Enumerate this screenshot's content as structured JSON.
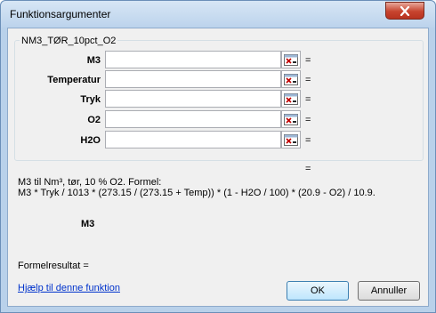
{
  "window": {
    "title": "Funktionsargumenter"
  },
  "function_name": "NM3_TØR_10pct_O2",
  "arguments": [
    {
      "label": "M3",
      "value": ""
    },
    {
      "label": "Temperatur",
      "value": ""
    },
    {
      "label": "Tryk",
      "value": ""
    },
    {
      "label": "O2",
      "value": ""
    },
    {
      "label": "H2O",
      "value": ""
    }
  ],
  "equals": "=",
  "description": {
    "line1": "M3 til Nm³, tør, 10 % O2. Formel:",
    "line2": "M3 * Tryk / 1013 * (273.15 / (273.15 + Temp)) * (1 - H2O / 100) * (20.9 - O2) / 10.9."
  },
  "selected_argument": "M3",
  "formula_result_label": "Formelresultat =",
  "help_link": "Hjælp til denne funktion",
  "buttons": {
    "ok": "OK",
    "cancel": "Annuller"
  },
  "icons": {
    "close": "close-icon",
    "range_ref": "range-reference-icon"
  }
}
